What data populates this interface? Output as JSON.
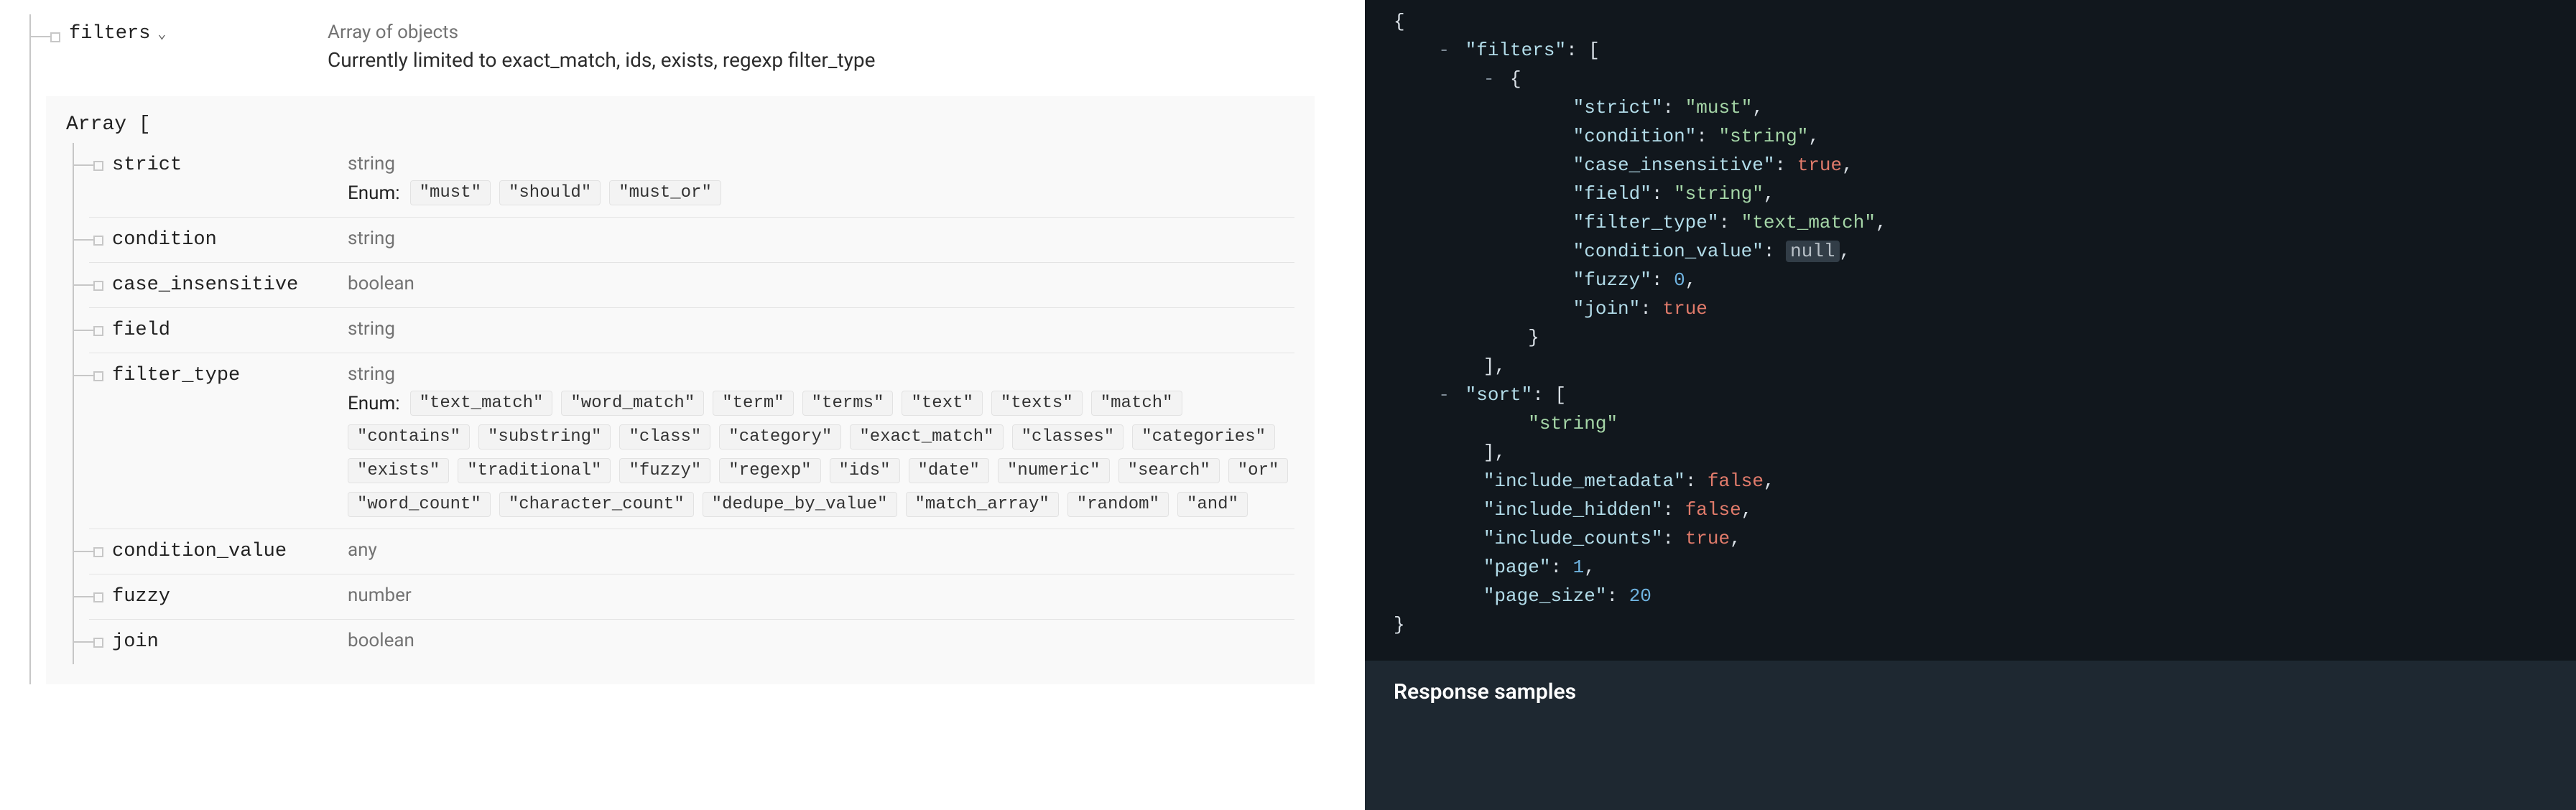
{
  "top_field": {
    "name": "filters",
    "type": "Array of objects",
    "description": "Currently limited to exact_match, ids, exists, regexp filter_type"
  },
  "array_label": "Array [",
  "enum_label": "Enum:",
  "props": [
    {
      "name": "strict",
      "type": "string",
      "enum": [
        "\"must\"",
        "\"should\"",
        "\"must_or\""
      ]
    },
    {
      "name": "condition",
      "type": "string"
    },
    {
      "name": "case_insensitive",
      "type": "boolean"
    },
    {
      "name": "field",
      "type": "string"
    },
    {
      "name": "filter_type",
      "type": "string",
      "enum": [
        "\"text_match\"",
        "\"word_match\"",
        "\"term\"",
        "\"terms\"",
        "\"text\"",
        "\"texts\"",
        "\"match\"",
        "\"contains\"",
        "\"substring\"",
        "\"class\"",
        "\"category\"",
        "\"exact_match\"",
        "\"classes\"",
        "\"categories\"",
        "\"exists\"",
        "\"traditional\"",
        "\"fuzzy\"",
        "\"regexp\"",
        "\"ids\"",
        "\"date\"",
        "\"numeric\"",
        "\"search\"",
        "\"or\"",
        "\"word_count\"",
        "\"character_count\"",
        "\"dedupe_by_value\"",
        "\"match_array\"",
        "\"random\"",
        "\"and\""
      ]
    },
    {
      "name": "condition_value",
      "type": "any"
    },
    {
      "name": "fuzzy",
      "type": "number"
    },
    {
      "name": "join",
      "type": "boolean"
    }
  ],
  "code_sample": {
    "filters": [
      {
        "strict": "must",
        "condition": "string",
        "case_insensitive": true,
        "field": "string",
        "filter_type": "text_match",
        "condition_value": null,
        "fuzzy": 0,
        "join": true
      }
    ],
    "sort": [
      "string"
    ],
    "include_metadata": false,
    "include_hidden": false,
    "include_counts": true,
    "page": 1,
    "page_size": 20
  },
  "response_samples_label": "Response samples"
}
